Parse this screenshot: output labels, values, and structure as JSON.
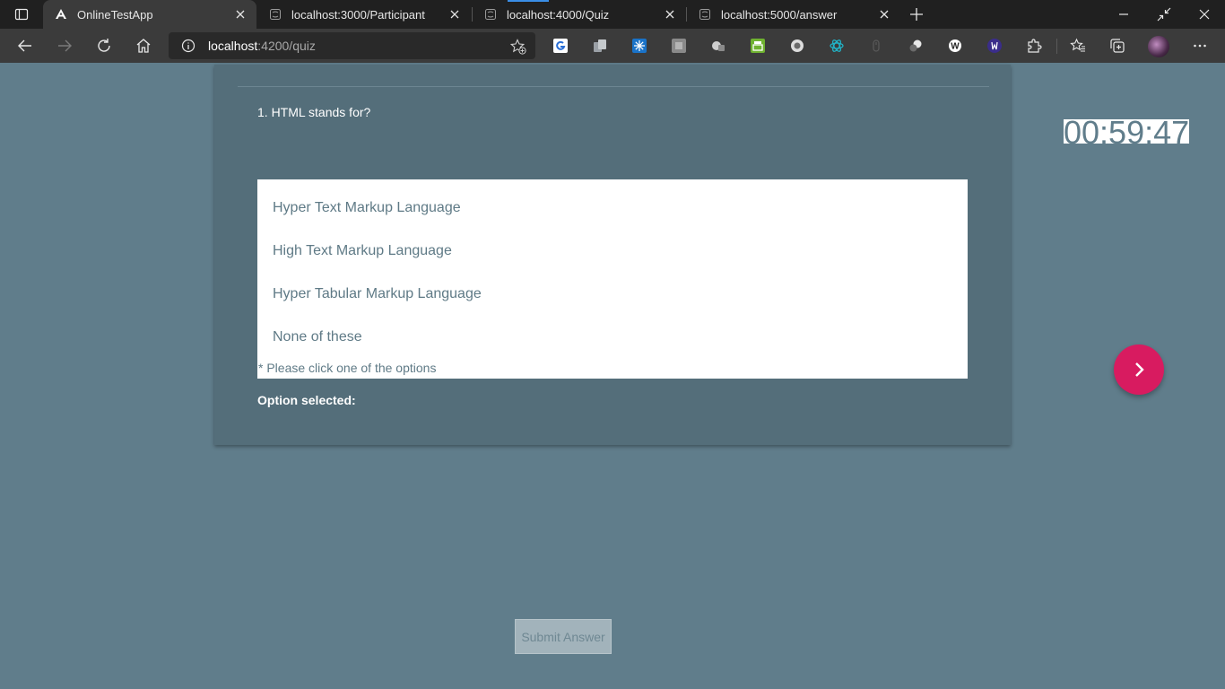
{
  "browser": {
    "tabs": [
      {
        "title": "OnlineTestApp",
        "active": true,
        "favicon": "angular-icon"
      },
      {
        "title": "localhost:3000/Participant",
        "active": false,
        "favicon": "page-icon"
      },
      {
        "title": "localhost:4000/Quiz",
        "active": false,
        "favicon": "page-icon"
      },
      {
        "title": "localhost:5000/answer",
        "active": false,
        "favicon": "page-icon"
      }
    ],
    "address": {
      "host": "localhost",
      "path": ":4200/quiz"
    },
    "extensions": [
      "extension-1",
      "extension-2",
      "extension-3",
      "extension-4",
      "extension-5",
      "extension-6",
      "extension-7",
      "extension-8",
      "extension-9",
      "extension-10",
      "extension-11",
      "extension-12"
    ]
  },
  "quiz": {
    "question": "1. HTML stands for?",
    "options": [
      "Hyper Text Markup Language",
      "High Text Markup Language",
      "Hyper Tabular Markup Language",
      "None of these"
    ],
    "hint": "* Please click one of the options",
    "selected_label": "Option selected:",
    "timer": "00:59:47",
    "submit_label": "Submit Answer"
  },
  "colors": {
    "page_bg": "#607d8b",
    "card_bg": "#546e7a",
    "accent": "#d81b60"
  }
}
